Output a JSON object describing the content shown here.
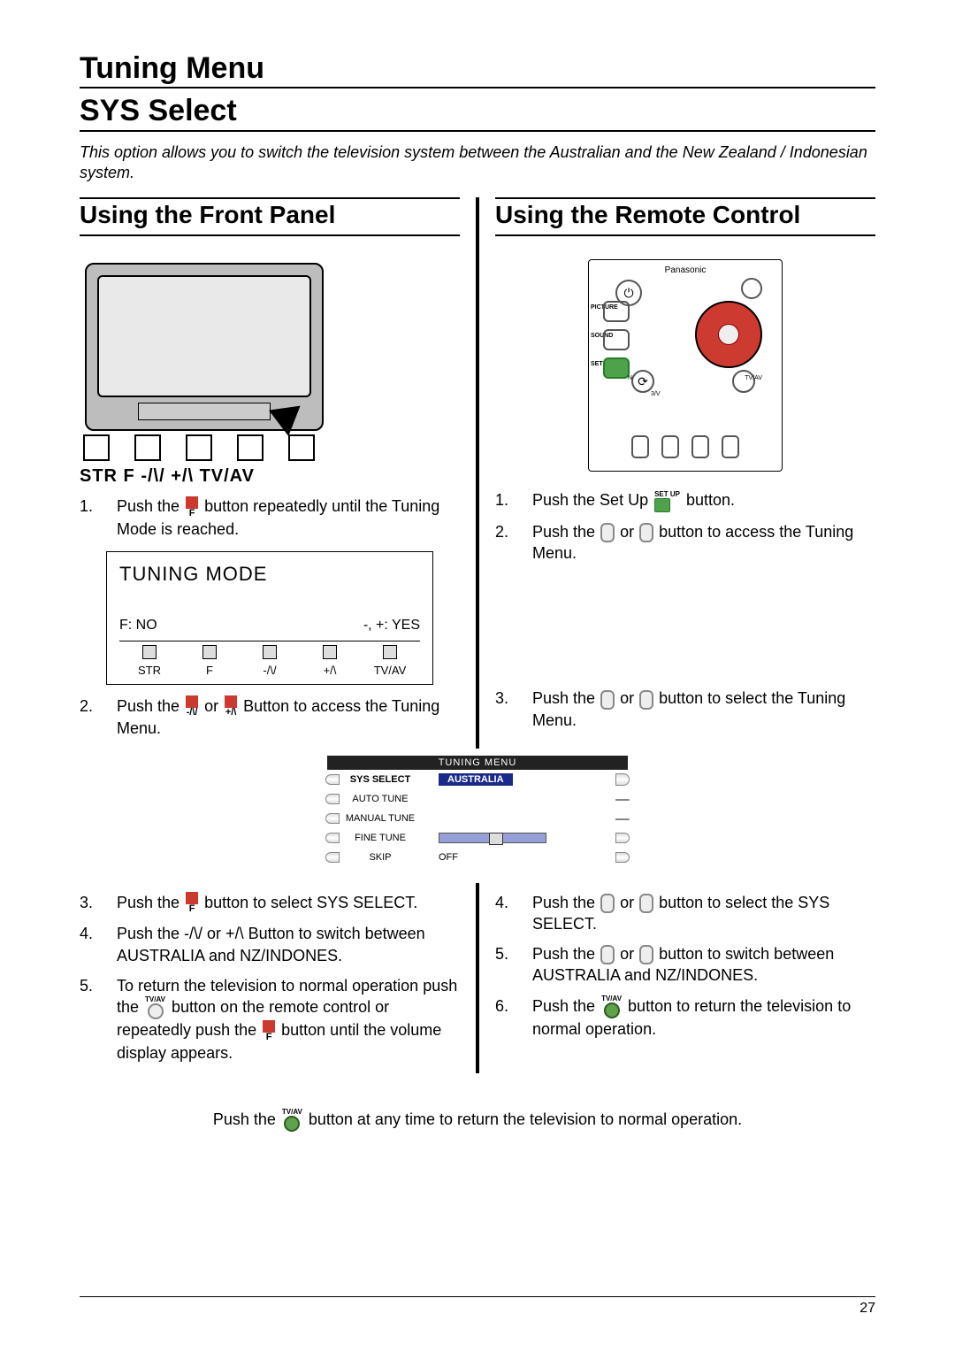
{
  "page_number": "27",
  "title_line1": "Tuning Menu",
  "title_line2": "SYS Select",
  "intro": "This option allows you to switch the television system between the Australian and the New Zealand / Indonesian system.",
  "left": {
    "heading": "Using the Front Panel",
    "panel_labels": "STR    F    -/\\/    +/\\    TV/AV",
    "step1a": "Push the ",
    "step1b": " button repeatedly until the Tuning Mode is reached.",
    "osd": {
      "title": "TUNING MODE",
      "no": "F: NO",
      "yes": "-, +: YES",
      "b1": "STR",
      "b2": "F",
      "b3": "-/\\/",
      "b4": "+/\\",
      "b5": "TV/AV"
    },
    "step2a": "Push the ",
    "step2b": " or ",
    "step2c": " Button to access the Tuning Menu.",
    "minus_lbl": "-/\\/",
    "plus_lbl": "+/\\",
    "step3a": "Push the ",
    "step3b": " button to select SYS SELECT.",
    "step4": "Push the -/\\/ or +/\\ Button to switch between AUSTRALIA and NZ/INDONES.",
    "step5a": "To return the television to normal operation push the ",
    "step5b": " button on the remote control or repeatedly push the ",
    "step5c": " button until the volume display appears."
  },
  "right": {
    "heading": "Using the Remote Control",
    "remote": {
      "brand": "Panasonic",
      "picture": "PICTURE",
      "sound": "SOUND",
      "setup": "SET UP",
      "n3v": "N",
      "tvav": "TV/AV",
      "three_v": "3/V"
    },
    "step1a": "Push the Set Up ",
    "step1b": " button.",
    "step2a": "Push the ",
    "step2b": " or ",
    "step2c": " button to access the Tuning Menu.",
    "step3a": "Push the ",
    "step3b": " or ",
    "step3c": " button to select the Tuning Menu.",
    "step4a": "Push the ",
    "step4b": " or ",
    "step4c": " button to select the SYS SELECT.",
    "step5a": "Push the ",
    "step5b": " or ",
    "step5c": " button to switch between AUSTRALIA and NZ/INDONES.",
    "step6a": "Push the ",
    "step6b": " button to return the television to normal operation."
  },
  "tuning_menu": {
    "header": "TUNING MENU",
    "rows": {
      "sys": "SYS SELECT",
      "sys_val": "AUSTRALIA",
      "auto": "AUTO TUNE",
      "manual": "MANUAL TUNE",
      "fine": "FINE TUNE",
      "skip": "SKIP",
      "skip_val": "OFF"
    }
  },
  "footnote_a": "Push the ",
  "footnote_b": " button at any time to return the television to normal operation.",
  "glyph": {
    "f": "F",
    "setup": "SET UP",
    "tvav": "TV/AV"
  }
}
